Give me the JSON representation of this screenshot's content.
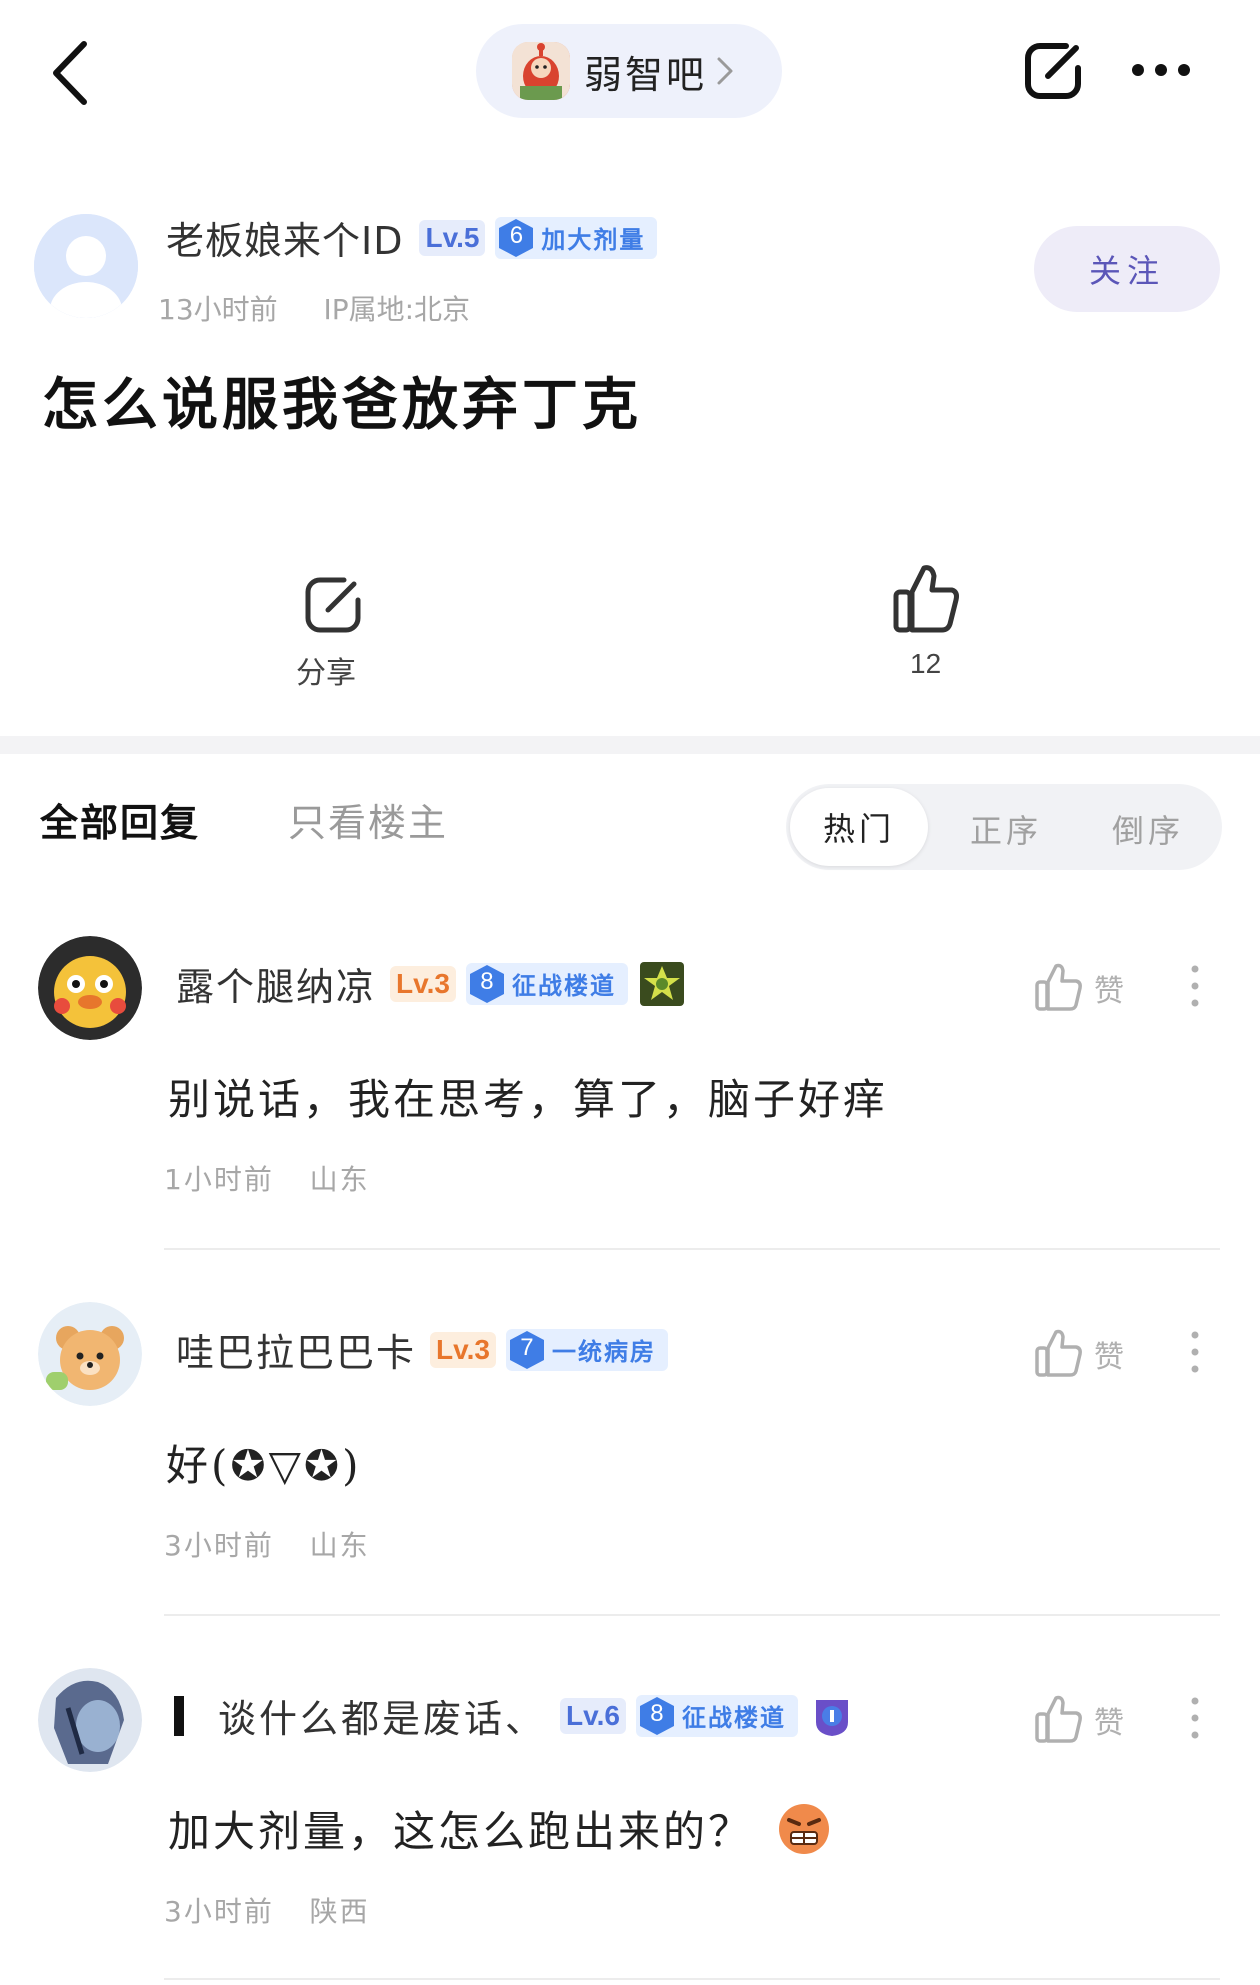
{
  "top_bar": {
    "forum_name": "弱智吧"
  },
  "post": {
    "author": {
      "name": "老板娘来个ID",
      "level": "Lv.5",
      "badge_number": "6",
      "badge_title": "加大剂量"
    },
    "time": "13小时前",
    "ip_location": "IP属地:北京",
    "follow_label": "关注",
    "title": "怎么说服我爸放弃丁克",
    "share_label": "分享",
    "like_count": "12"
  },
  "tabs": {
    "all_replies": "全部回复",
    "op_only": "只看楼主",
    "sort_hot": "热门",
    "sort_asc": "正序",
    "sort_desc": "倒序"
  },
  "comments": [
    {
      "name": "露个腿纳凉",
      "level": "Lv.3",
      "badge_number": "8",
      "badge_title": "征战楼道",
      "text": "别说话，我在思考，算了，脑子好痒",
      "time": "1小时前",
      "location": "山东",
      "like_label": "赞"
    },
    {
      "name": "哇巴拉巴巴卡",
      "level": "Lv.3",
      "badge_number": "7",
      "badge_title": "一统病房",
      "text": "好(✪▽✪)",
      "time": "3小时前",
      "location": "山东",
      "like_label": "赞"
    },
    {
      "name": "谈什么都是废话、",
      "level": "Lv.6",
      "badge_number": "8",
      "badge_title": "征战楼道",
      "text": "加大剂量，这怎么跑出来的？",
      "time": "3小时前",
      "location": "陕西",
      "like_label": "赞"
    }
  ],
  "colors": {
    "accent_follow": "#5b56b8",
    "level_orange": "#e8762c",
    "level_blue": "#4a6fd8",
    "badge_blue": "#3f7de6"
  }
}
